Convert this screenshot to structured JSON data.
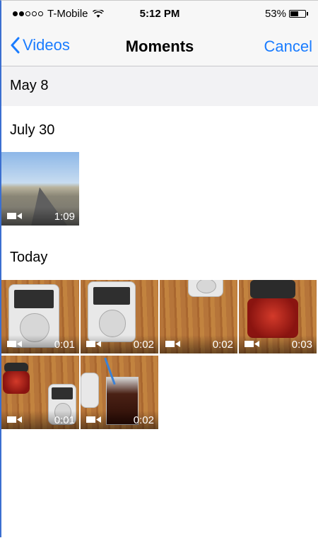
{
  "status_bar": {
    "carrier": "T-Mobile",
    "time": "5:12 PM",
    "battery": "53%",
    "signal_bars_filled": 2,
    "signal_bars_total": 5
  },
  "nav": {
    "back_label": "Videos",
    "title": "Moments",
    "cancel_label": "Cancel"
  },
  "sections": [
    {
      "title": "May 8",
      "videos": []
    },
    {
      "title": "July 30",
      "videos": [
        {
          "duration": "1:09",
          "icon": "video-camera-icon"
        }
      ]
    },
    {
      "title": "Today",
      "videos": [
        {
          "duration": "0:01",
          "icon": "video-camera-icon"
        },
        {
          "duration": "0:02",
          "icon": "video-camera-icon"
        },
        {
          "duration": "0:02",
          "icon": "video-camera-icon"
        },
        {
          "duration": "0:03",
          "icon": "video-camera-icon"
        },
        {
          "duration": "0:01",
          "icon": "video-camera-icon"
        },
        {
          "duration": "0:02",
          "icon": "video-camera-icon"
        }
      ]
    }
  ],
  "colors": {
    "accent": "#1a7cff",
    "bar_background": "#f7f7f7",
    "section_strip": "#f2f2f4"
  }
}
